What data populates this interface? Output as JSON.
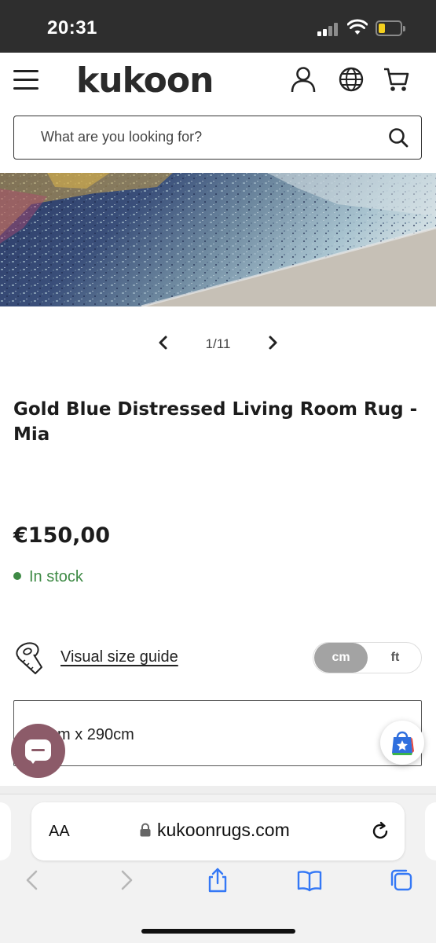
{
  "status_bar": {
    "time": "20:31"
  },
  "header": {
    "logo": "kukoon",
    "icons": [
      "menu-icon",
      "account-icon",
      "globe-icon",
      "cart-icon"
    ]
  },
  "search": {
    "placeholder": "What are you looking for?"
  },
  "carousel": {
    "counter": "1/11"
  },
  "product": {
    "title": "Gold Blue Distressed Living Room Rug - Mia",
    "price": "€150,00",
    "stock": "In stock",
    "stock_color": "#3e8a45"
  },
  "size_guide": {
    "link_label": "Visual size guide",
    "units": [
      "cm",
      "ft"
    ],
    "selected_unit": "cm"
  },
  "size_select": {
    "value": "cm x 290cm"
  },
  "browser": {
    "aa_label": "AA",
    "url": "kukoonrugs.com"
  },
  "colors": {
    "chat_button": "#8c5b69",
    "ios_blue": "#3478f6"
  }
}
